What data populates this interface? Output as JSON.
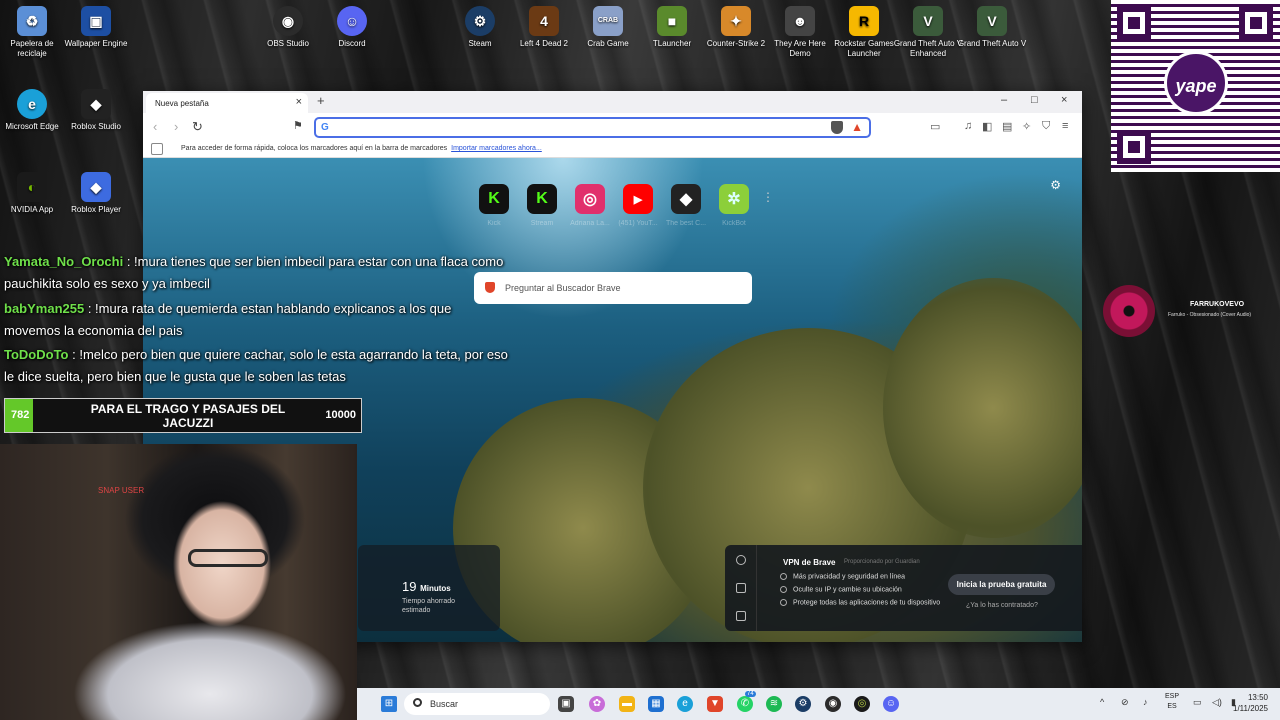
{
  "desktop": {
    "icons": [
      {
        "label": "Papelera de reciclaje",
        "icon": "recycle-bin-icon",
        "color": "#5b8fd6"
      },
      {
        "label": "Wallpaper Engine",
        "icon": "wallpaper-engine-icon",
        "color": "#1d4fa3"
      },
      {
        "label": "OBS Studio",
        "icon": "obs-icon",
        "color": "#2b2b2b"
      },
      {
        "label": "Discord",
        "icon": "discord-icon",
        "color": "#5865f2"
      },
      {
        "label": "Steam",
        "icon": "steam-icon",
        "color": "#1b3d66"
      },
      {
        "label": "Left 4 Dead 2",
        "icon": "left4dead-icon",
        "color": "#6b3a14"
      },
      {
        "label": "Crab Game",
        "icon": "crab-game-icon",
        "color": "#8aa0c8"
      },
      {
        "label": "TLauncher",
        "icon": "tlauncher-icon",
        "color": "#5a8a2c"
      },
      {
        "label": "Counter-Strike 2",
        "icon": "cs2-icon",
        "color": "#d8892a"
      },
      {
        "label": "They Are Here Demo",
        "icon": "alien-icon",
        "color": "#444"
      },
      {
        "label": "Rockstar Games Launcher",
        "icon": "rockstar-icon",
        "color": "#f6b800"
      },
      {
        "label": "Grand Theft Auto V Enhanced",
        "icon": "gta-icon",
        "color": "#3b5b3b"
      },
      {
        "label": "Grand Theft Auto V",
        "icon": "gta-icon",
        "color": "#3b5b3b"
      },
      {
        "label": "Microsoft Edge",
        "icon": "edge-icon",
        "color": "#1aa0d8"
      },
      {
        "label": "Roblox Studio",
        "icon": "roblox-studio-icon",
        "color": "#222"
      },
      {
        "label": "NVIDIA App",
        "icon": "nvidia-icon",
        "color": "#76b900"
      },
      {
        "label": "Roblox Player",
        "icon": "roblox-icon",
        "color": "#3d6be0"
      }
    ]
  },
  "browser": {
    "tab_title": "Nueva pestaña",
    "url_value": "",
    "bookmarks_hint": "Para acceder de forma rápida, coloca los marcadores aquí en la barra de marcadores",
    "bookmarks_import": "Importar marcadores ahora...",
    "top_sites": [
      {
        "label": "Kick",
        "glyph": "K",
        "bg": "#111",
        "fg": "#53fc18"
      },
      {
        "label": "Stream",
        "glyph": "K",
        "bg": "#111",
        "fg": "#53fc18"
      },
      {
        "label": "Adriana La...",
        "glyph": "◎",
        "bg": "#e1306c",
        "fg": "#fff"
      },
      {
        "label": "(451) YouT...",
        "glyph": "▶",
        "bg": "#ff0000",
        "fg": "#fff"
      },
      {
        "label": "The best C...",
        "glyph": "◆",
        "bg": "#222",
        "fg": "#fff"
      },
      {
        "label": "KickBot",
        "glyph": "✲",
        "bg": "#8ccf3a",
        "fg": "#dff"
      }
    ],
    "search_placeholder": "Preguntar al Buscador Brave",
    "savings": {
      "value": "19",
      "unit": "Minutos",
      "label": "Tiempo ahorrado estimado"
    },
    "vpn": {
      "title": "VPN de Brave",
      "provider": "Proporcionado por Guardian",
      "bullets": [
        "Más privacidad y seguridad en línea",
        "Oculte su IP y cambie su ubicación",
        "Protege todas las aplicaciones de tu dispositivo"
      ],
      "cta": "Inicia la prueba gratuita",
      "already": "¿Ya lo has contratado?"
    }
  },
  "chat": [
    {
      "user": "Yamata_No_Orochi",
      "message": " : !mura tienes que ser bien imbecil para estar con una flaca como pauchikita solo es sexo y ya imbecil"
    },
    {
      "user": "babYman255",
      "message": " : !mura rata de quemierda estan hablando explicanos a los que movemos la economia del pais"
    },
    {
      "user": "ToDoDoTo",
      "message": " : !melco pero bien que quiere cachar, solo le esta agarrando la teta, por eso le dice suelta, pero bien que le gusta que le soben las tetas"
    }
  ],
  "goal": {
    "current": "782",
    "name": "PARA EL TRAGO Y PASAJES DEL JACUZZI",
    "target": "10000",
    "progress": 0.0782,
    "color": "#64c829"
  },
  "overlay": {
    "qr_brand": "yape",
    "music_artist": "FARRUKOVEVO",
    "music_song": "Farruko - Obsesionado (Cover Audio)",
    "cam_text": "SNAP USER"
  },
  "taskbar": {
    "search_placeholder": "Buscar",
    "lang_top": "ESP",
    "lang_bottom": "ES",
    "time": "13:50",
    "date": "1/11/2025",
    "whatsapp_badge": "74"
  }
}
